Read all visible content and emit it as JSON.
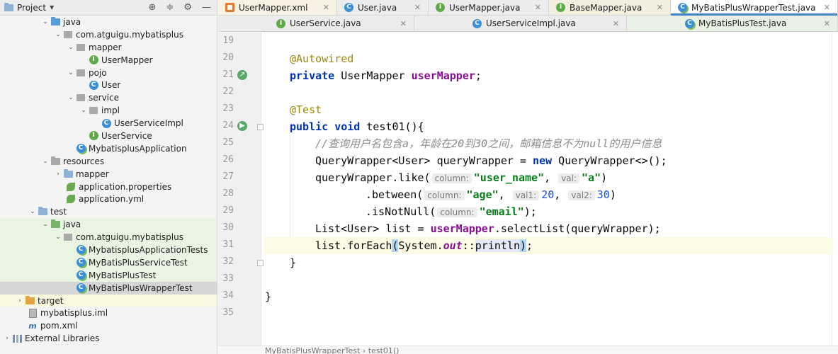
{
  "project_panel": {
    "title": "Project",
    "tree": [
      {
        "label": "java",
        "icon": "java-folder-icon"
      },
      {
        "label": "com.atguigu.mybatisplus",
        "icon": "package-icon"
      },
      {
        "label": "mapper",
        "icon": "package-icon"
      },
      {
        "label": "UserMapper",
        "icon": "interface-icon"
      },
      {
        "label": "pojo",
        "icon": "package-icon"
      },
      {
        "label": "User",
        "icon": "class-icon"
      },
      {
        "label": "service",
        "icon": "package-icon"
      },
      {
        "label": "impl",
        "icon": "package-icon"
      },
      {
        "label": "UserServiceImpl",
        "icon": "class-icon"
      },
      {
        "label": "UserService",
        "icon": "interface-icon"
      },
      {
        "label": "MybatisplusApplication",
        "icon": "spring-class-icon"
      },
      {
        "label": "resources",
        "icon": "resources-folder-icon"
      },
      {
        "label": "mapper",
        "icon": "folder-icon"
      },
      {
        "label": "application.properties",
        "icon": "spring-config-icon"
      },
      {
        "label": "application.yml",
        "icon": "spring-config-icon"
      },
      {
        "label": "test",
        "icon": "folder-icon"
      },
      {
        "label": "java",
        "icon": "test-folder-icon"
      },
      {
        "label": "com.atguigu.mybatisplus",
        "icon": "package-icon"
      },
      {
        "label": "MybatisplusApplicationTests",
        "icon": "test-class-icon"
      },
      {
        "label": "MyBatisPlusServiceTest",
        "icon": "test-class-icon"
      },
      {
        "label": "MyBatisPlusTest",
        "icon": "test-class-icon"
      },
      {
        "label": "MyBatisPlusWrapperTest",
        "icon": "test-class-icon"
      },
      {
        "label": "target",
        "icon": "excluded-folder-icon"
      },
      {
        "label": "mybatisplus.iml",
        "icon": "iml-file-icon"
      },
      {
        "label": "pom.xml",
        "icon": "maven-icon"
      },
      {
        "label": "External Libraries",
        "icon": "library-icon"
      }
    ]
  },
  "tabs_row1": [
    {
      "label": "UserMapper.xml"
    },
    {
      "label": "User.java"
    },
    {
      "label": "UserMapper.java"
    },
    {
      "label": "BaseMapper.java"
    },
    {
      "label": "MyBatisPlusWrapperTest.java"
    }
  ],
  "tabs_row2": [
    {
      "label": "UserService.java"
    },
    {
      "label": "UserServiceImpl.java"
    },
    {
      "label": "MyBatisPlusTest.java"
    }
  ],
  "code": {
    "line_numbers": [
      "19",
      "20",
      "21",
      "22",
      "23",
      "24",
      "25",
      "26",
      "27",
      "28",
      "29",
      "30",
      "31",
      "32",
      "33",
      "34",
      "35"
    ],
    "l20": "@Autowired",
    "l21_kw": "private",
    "l21_type": " UserMapper ",
    "l21_field": "userMapper",
    "l21_end": ";",
    "l23": "@Test",
    "l24_kw1": "public",
    "l24_kw2": " void",
    "l24_rest": " test01(){",
    "l25": "//查询用户名包含a，年龄在20到30之间，邮箱信息不为null的用户信息",
    "l26_a": "QueryWrapper<User> queryWrapper = ",
    "l26_kw": "new",
    "l26_b": " QueryWrapper<>();",
    "l27_a": "queryWrapper.like(",
    "l27_h1": "column:",
    "l27_s1": "\"user_name\"",
    "l27_c": ",",
    "l27_h2": "val:",
    "l27_s2": "\"a\"",
    "l27_end": ")",
    "l28_a": ".between(",
    "l28_h1": "column:",
    "l28_s1": "\"age\"",
    "l28_c1": ",",
    "l28_h2": "val1:",
    "l28_n1": "20",
    "l28_c2": ",",
    "l28_h3": "val2:",
    "l28_n2": "30",
    "l28_end": ")",
    "l29_a": ".isNotNull(",
    "l29_h1": "column:",
    "l29_s1": "\"email\"",
    "l29_end": ");",
    "l30_a": "List<User> list = ",
    "l30_field": "userMapper",
    "l30_b": ".selectList(queryWrapper);",
    "l31_a": "list.forEach",
    "l31_p1": "(",
    "l31_b": "System.",
    "l31_out": "out",
    "l31_c": "::",
    "l31_println": "println",
    "l31_p2": ")",
    "l31_end": ";",
    "l32": "}",
    "l34": "}"
  },
  "breadcrumb": "MyBatisPlusWrapperTest  ›  test01()"
}
